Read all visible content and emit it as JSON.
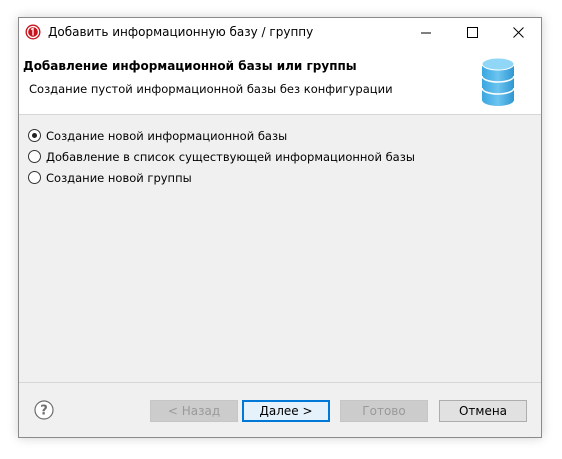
{
  "window": {
    "title": "Добавить информационную базу / группу",
    "app_icon": "1c-logo-icon",
    "controls": {
      "minimize": "minimize-icon",
      "maximize": "maximize-icon",
      "close": "close-icon"
    }
  },
  "header": {
    "title": "Добавление информационной базы или группы",
    "subtitle": "Создание пустой информационной базы без конфигурации",
    "icon": "database-icon"
  },
  "options": [
    {
      "label": "Создание новой информационной базы",
      "checked": true
    },
    {
      "label": "Добавление в список существующей информационной базы",
      "checked": false
    },
    {
      "label": "Создание новой группы",
      "checked": false
    }
  ],
  "footer": {
    "help_icon": "help-icon",
    "back_label": "< Назад",
    "next_label": "Далее >",
    "finish_label": "Готово",
    "cancel_label": "Отмена"
  },
  "colors": {
    "accent": "#0078d7",
    "logo_red": "#d51a1a"
  }
}
